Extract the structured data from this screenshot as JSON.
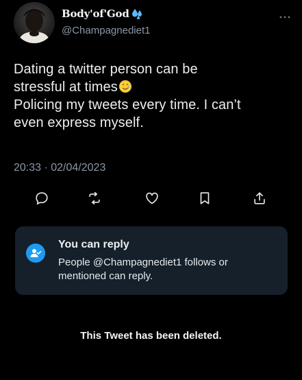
{
  "tweet": {
    "author": {
      "display_name": "Body'of'God",
      "name_emoji": "sweat-droplets-icon",
      "handle": "@Champagnediet1"
    },
    "text_lines": [
      "Dating a twitter person can be",
      "stressful at times",
      "Policing my tweets every time. I can’t",
      "even express myself."
    ],
    "inline_emoji": "smiling-face-with-tear-icon",
    "timestamp": "20:33 · 02/04/2023",
    "actions": [
      "reply-icon",
      "retweet-icon",
      "like-icon",
      "bookmark-icon",
      "share-icon"
    ]
  },
  "reply_restriction": {
    "title": "You can reply",
    "body": "People @Champagnediet1 follows or mentioned can reply.",
    "icon": "user-check-icon"
  },
  "deleted_notice": "This Tweet has been deleted.",
  "colors": {
    "background": "#000000",
    "text": "#e7e9ea",
    "muted": "#8b98a5",
    "card": "#15202b",
    "accent": "#1d9bf0"
  }
}
